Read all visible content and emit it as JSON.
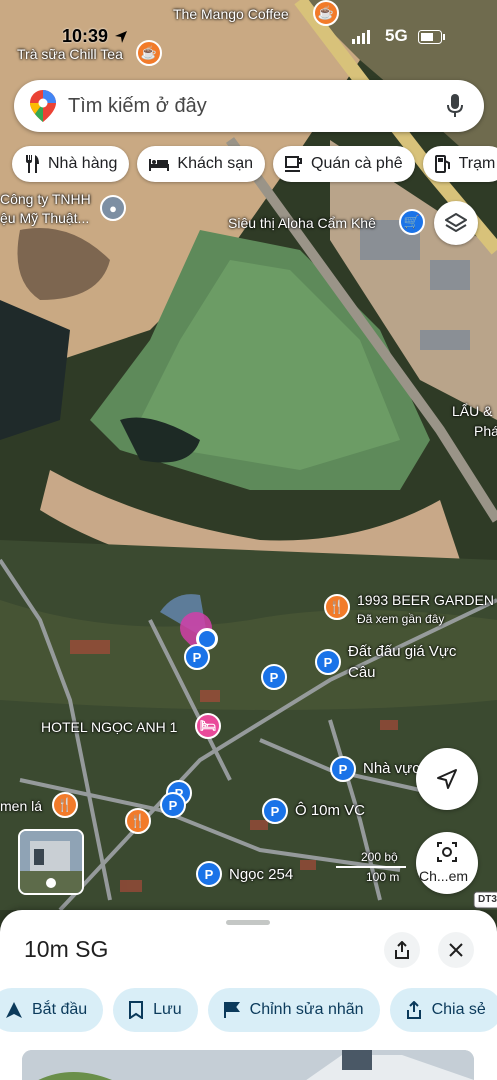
{
  "status": {
    "time": "10:39",
    "network": "5G"
  },
  "search": {
    "placeholder": "Tìm kiếm ở đây"
  },
  "chips": [
    {
      "label": "Nhà hàng",
      "icon": "fork-knife-icon"
    },
    {
      "label": "Khách sạn",
      "icon": "bed-icon"
    },
    {
      "label": "Quán cà phê",
      "icon": "coffee-icon"
    },
    {
      "label": "Trạm",
      "icon": "fuel-icon"
    }
  ],
  "map_labels": {
    "mango_coffee": "The Mango Coffee",
    "chill_tea": "Trà sữa Chill Tea",
    "cong_ty_line1": "Công ty TNHH",
    "cong_ty_line2": "ệu Mỹ Thuật...",
    "aloha": "Siêu thị Aloha Cẩm Khê",
    "lau_line1": "LẨU &",
    "lau_line2": "Phá",
    "beer_garden": "1993 BEER GARDEN",
    "beer_sub": "Đã xem gần đây",
    "dat_dau_line1": "Đất đấu giá Vực",
    "dat_dau_line2": "Câu",
    "hotel": "HOTEL NGỌC ANH 1",
    "nha_vuc": "Nhà vực",
    "o_10m": "Ô 10m VC",
    "men_la": "men lá",
    "ngoc_254": "Ngọc 254",
    "scale_ft": "200 bộ",
    "scale_m": "100 m",
    "road_label": "DT3",
    "lens_label": "Ch...em"
  },
  "sheet": {
    "title": "10m SG",
    "actions": [
      {
        "label": "Bắt đầu",
        "icon": "navigate-icon"
      },
      {
        "label": "Lưu",
        "icon": "bookmark-icon"
      },
      {
        "label": "Chỉnh sửa nhãn",
        "icon": "flag-icon"
      },
      {
        "label": "Chia sẻ",
        "icon": "share-icon"
      }
    ]
  },
  "colors": {
    "accent": "#1a73e8",
    "orange_pin": "#f27b2a",
    "pink_pin": "#e94a9a",
    "action_bg": "#d9eef7"
  }
}
